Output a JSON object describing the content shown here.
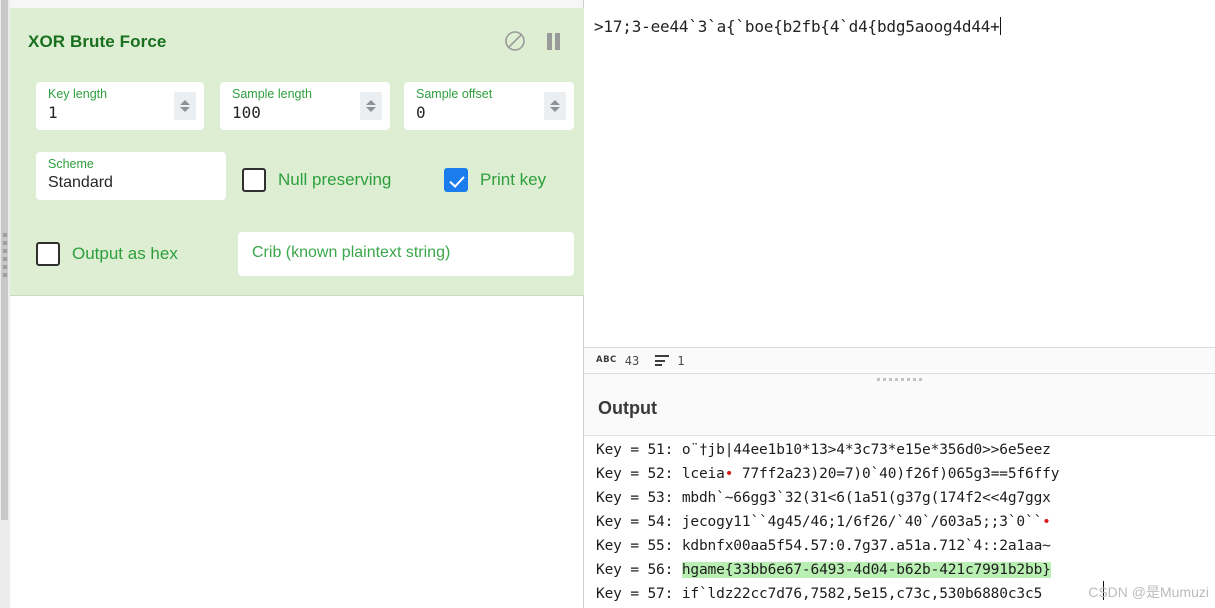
{
  "operation": {
    "title": "XOR Brute Force",
    "icons": {
      "disable": "disable-circle-slash-icon",
      "pause": "pause-icon"
    },
    "fields": [
      {
        "label": "Key length",
        "value": "1",
        "name": "key-length"
      },
      {
        "label": "Sample length",
        "value": "100",
        "name": "sample-length"
      },
      {
        "label": "Sample offset",
        "value": "0",
        "name": "sample-offset"
      }
    ],
    "scheme": {
      "label": "Scheme",
      "value": "Standard"
    },
    "checkboxes": [
      {
        "label": "Null preserving",
        "checked": false,
        "name": "null-preserving"
      },
      {
        "label": "Print key",
        "checked": true,
        "name": "print-key"
      },
      {
        "label": "Output as hex",
        "checked": false,
        "name": "output-as-hex"
      }
    ],
    "crib": {
      "placeholder": "Crib (known plaintext string)",
      "value": ""
    }
  },
  "input": {
    "text": ">17;3-ee44`3`a{`boe{b2fb{4`d4{bdg5aoog4d44+"
  },
  "status": {
    "char_count": "43",
    "line_count": "1",
    "char_icon": "abc-icon",
    "line_icon": "line-count-icon"
  },
  "output": {
    "title": "Output",
    "lines": [
      {
        "prefix": "Key = 51: ",
        "text": "o¨†jb|44ee1b10*13>4*3c73*e15e*356d0>>6e5eez",
        "highlight": false
      },
      {
        "prefix": "Key = 52: ",
        "text": "lceia• 77ff2a23)20=7)0`40)f26f)065g3==5f6ffy",
        "highlight": false
      },
      {
        "prefix": "Key = 53: ",
        "text": "mbdh`~66gg3`32(31<6(1a51(g37g(174f2<<4g7ggx",
        "highlight": false
      },
      {
        "prefix": "Key = 54: ",
        "text": "jecogy11``4g45/46;1/6f26/`40`/603a5;;3`0``•",
        "highlight": false
      },
      {
        "prefix": "Key = 55: ",
        "text": "kdbnfx00aa5f54.57:0.7g37.a51a.712`4::2a1aa~",
        "highlight": false
      },
      {
        "prefix": "Key = 56: ",
        "text": "hgame{33bb6e67-6493-4d04-b62b-421c7991b2bb}",
        "highlight": true
      },
      {
        "prefix": "Key = 57: ",
        "text": "if`ldz22cc7d76,7582,5e15,c73c,530b6880c3c5",
        "highlight": false
      }
    ]
  },
  "watermark": "CSDN @是Mumuzi",
  "colors": {
    "panel_green": "#ddeed3",
    "label_green": "#2e9f3d",
    "title_green": "#18701f",
    "checkbox_blue": "#1b7ced",
    "highlight_green": "#b9efb2",
    "control_char_red": "#e01b1b"
  }
}
